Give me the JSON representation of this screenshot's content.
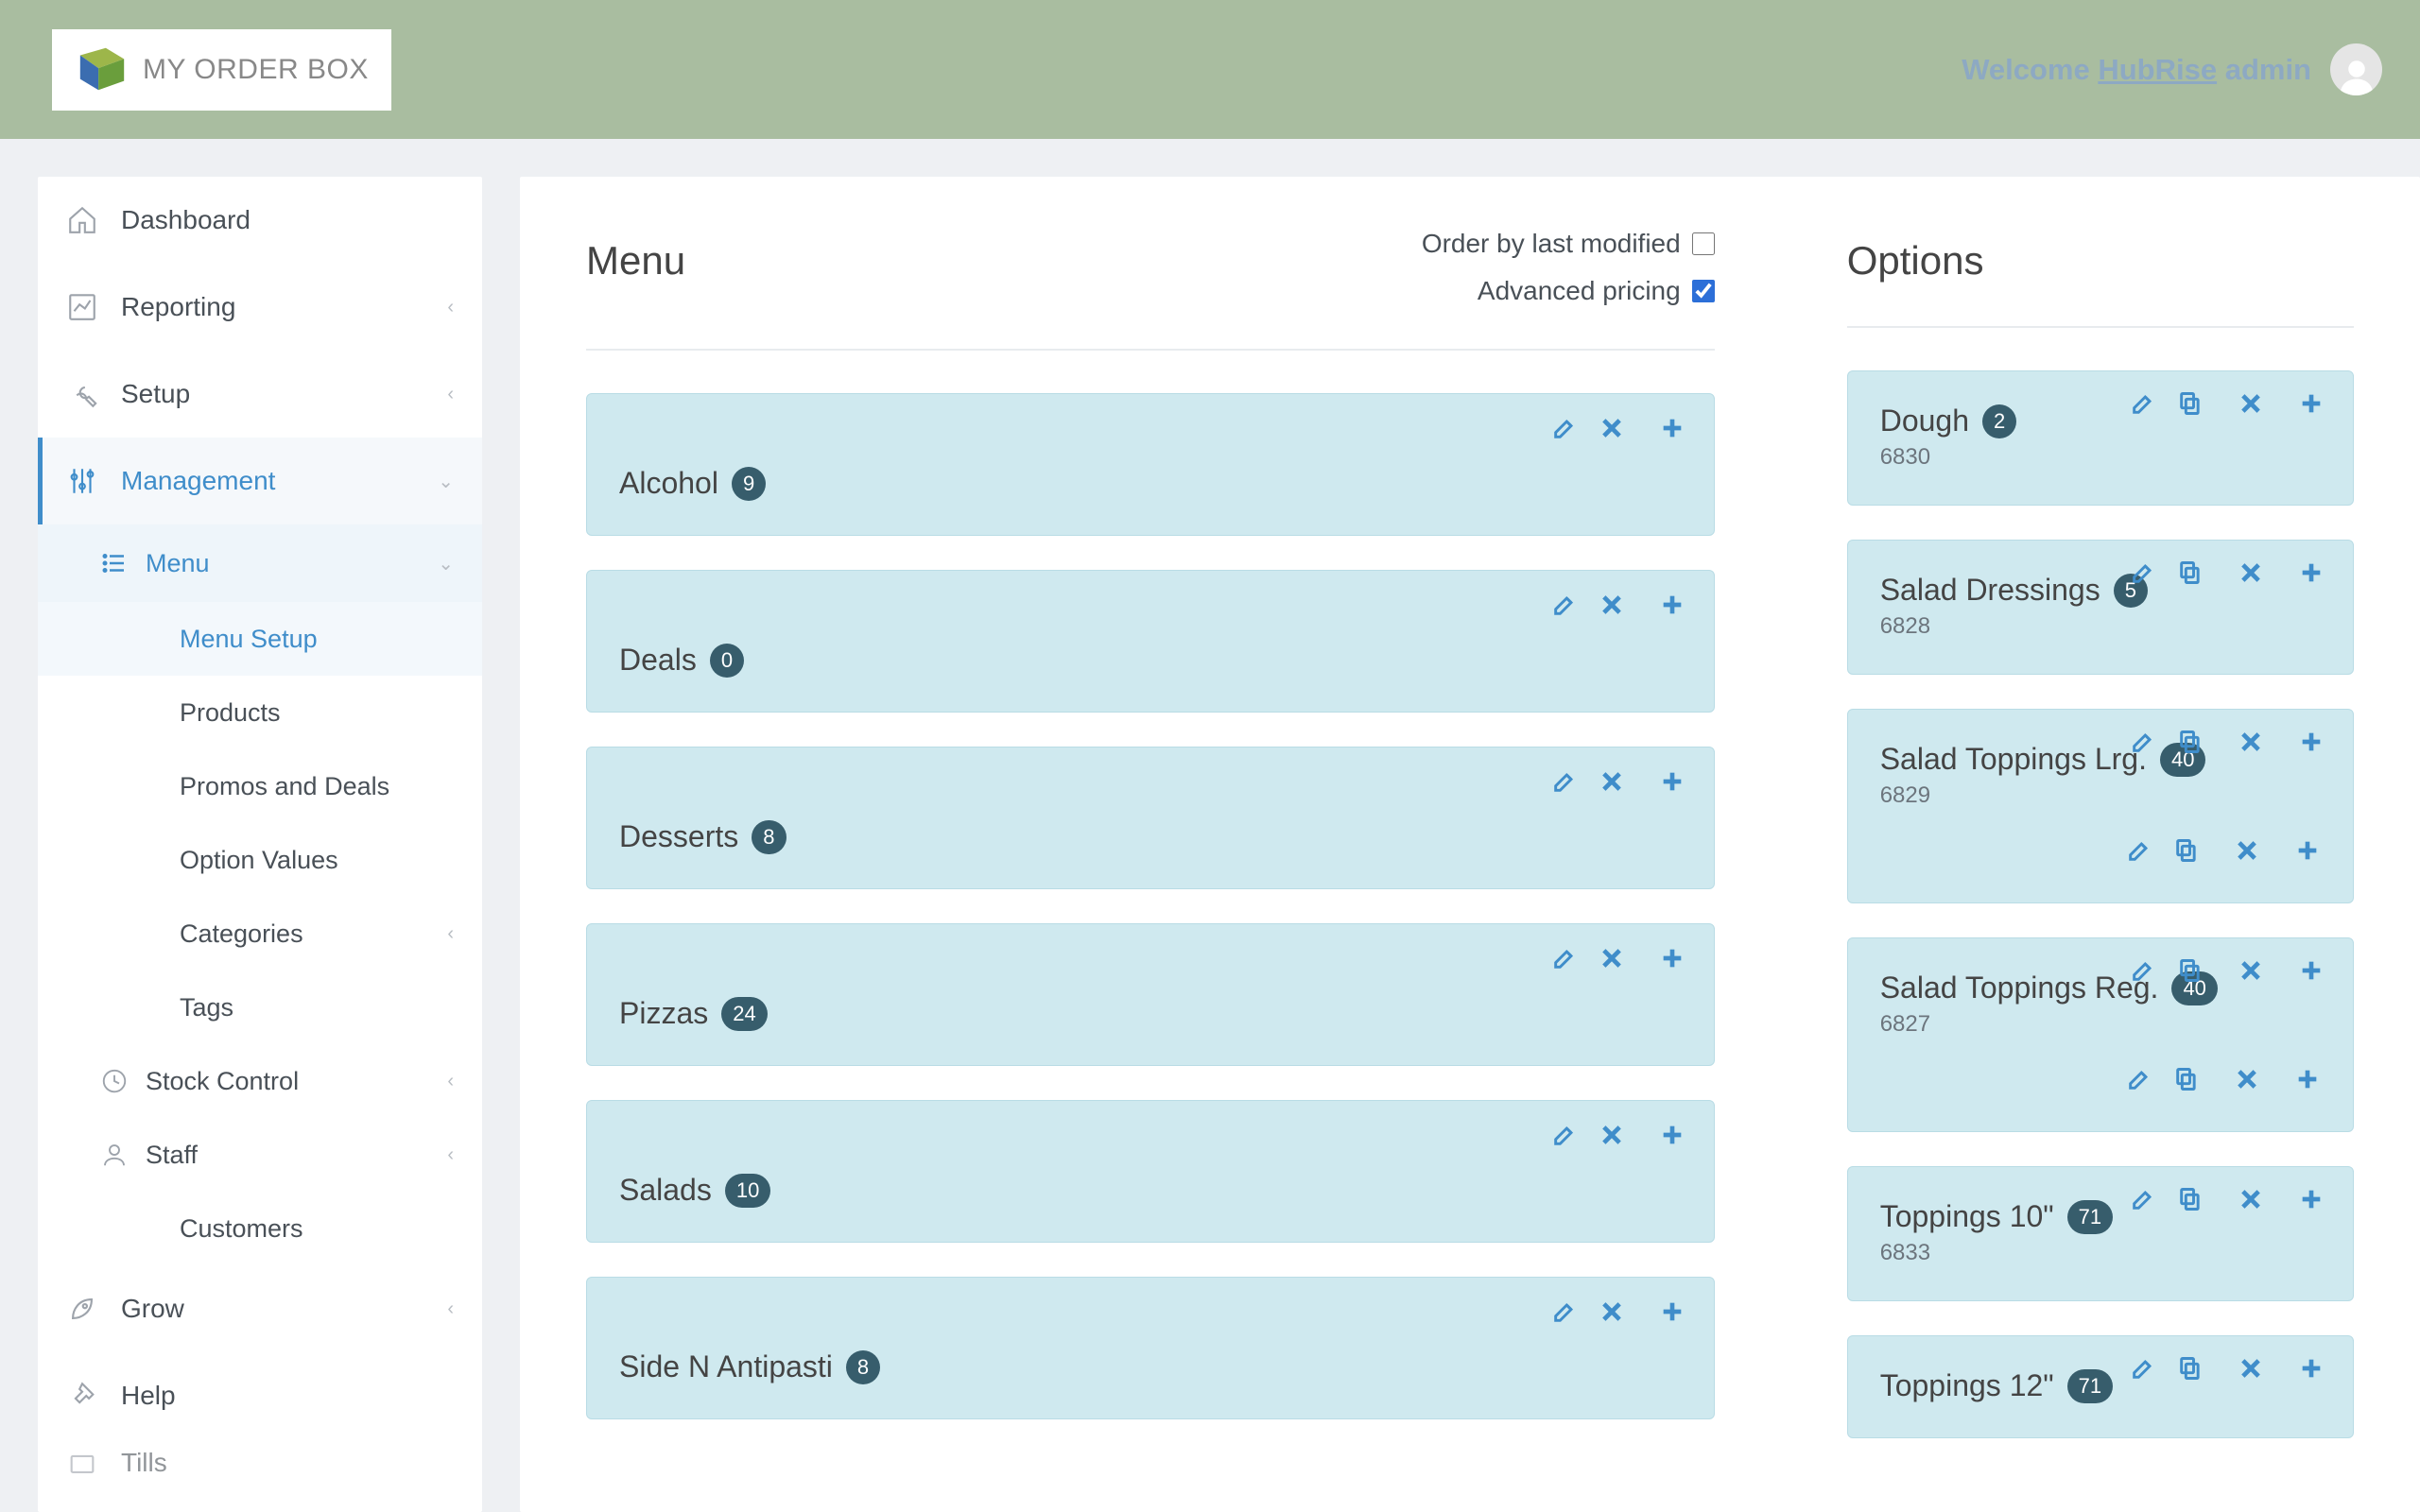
{
  "brand": {
    "name": "MY ORDER BOX"
  },
  "header": {
    "welcome_prefix": "Welcome ",
    "org_link": "HubRise",
    "welcome_suffix": " admin"
  },
  "nav": {
    "dashboard": "Dashboard",
    "reporting": "Reporting",
    "setup": "Setup",
    "management": "Management",
    "menu": "Menu",
    "menu_setup": "Menu Setup",
    "products": "Products",
    "promos": "Promos and Deals",
    "option_values": "Option Values",
    "categories": "Categories",
    "tags": "Tags",
    "stock_control": "Stock Control",
    "staff": "Staff",
    "customers": "Customers",
    "grow": "Grow",
    "help": "Help",
    "tills": "Tills"
  },
  "menu_section": {
    "title": "Menu",
    "order_by_last_modified_label": "Order by last modified",
    "order_by_last_modified": false,
    "advanced_pricing_label": "Advanced pricing",
    "advanced_pricing": true,
    "categories": [
      {
        "name": "Alcohol",
        "count": 9
      },
      {
        "name": "Deals",
        "count": 0
      },
      {
        "name": "Desserts",
        "count": 8
      },
      {
        "name": "Pizzas",
        "count": 24
      },
      {
        "name": "Salads",
        "count": 10
      },
      {
        "name": "Side N Antipasti",
        "count": 8
      }
    ]
  },
  "options_section": {
    "title": "Options",
    "items": [
      {
        "name": "Dough",
        "count": 2,
        "code": "6830",
        "wrap": false
      },
      {
        "name": "Salad Dressings",
        "count": 5,
        "code": "6828",
        "wrap": false
      },
      {
        "name": "Salad Toppings Lrg.",
        "count": 40,
        "code": "6829",
        "wrap": true
      },
      {
        "name": "Salad Toppings Reg.",
        "count": 40,
        "code": "6827",
        "wrap": true
      },
      {
        "name": "Toppings 10\"",
        "count": 71,
        "code": "6833",
        "wrap": false
      },
      {
        "name": "Toppings 12\"",
        "count": 71,
        "code": "",
        "wrap": false
      }
    ]
  }
}
